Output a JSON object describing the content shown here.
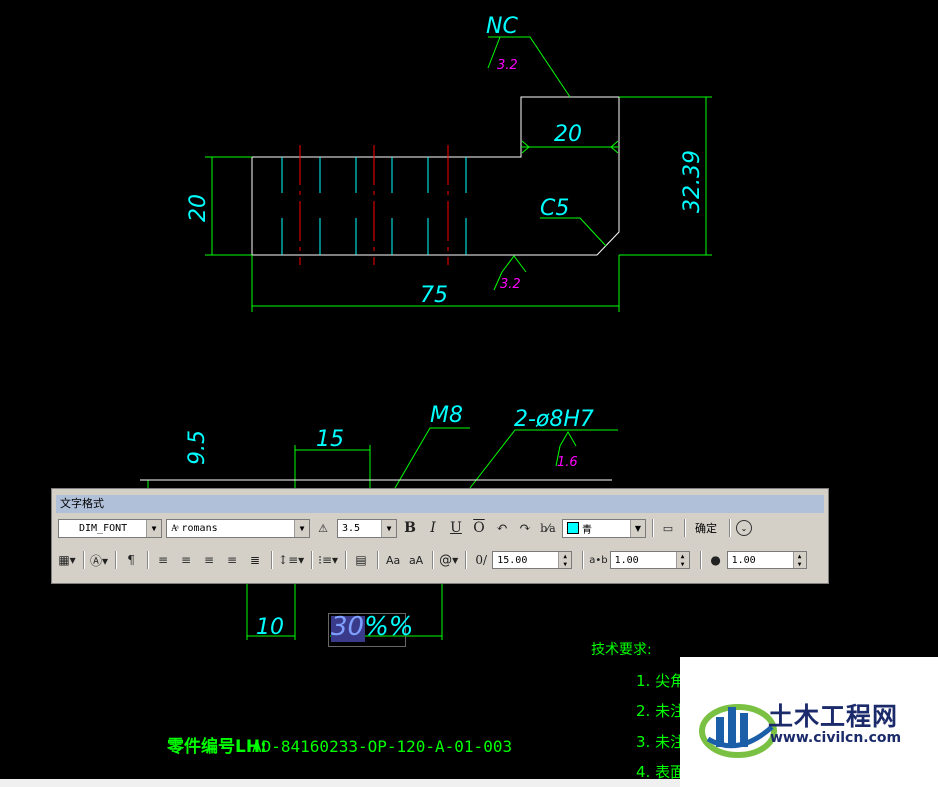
{
  "drawing": {
    "top_view": {
      "dim_top_width": "20",
      "dim_height_total": "32.39",
      "dim_left_height": "20",
      "dim_length": "75",
      "chamfer_label": "C5",
      "surface_symbol_top_label": "NC",
      "roughness_top": "3.2",
      "roughness_bottom": "3.2"
    },
    "side_view": {
      "dim_vertical": "9.5",
      "dim_15": "15",
      "thread_label": "M8",
      "hole_label": "2-ø8H7",
      "roughness_hole": "1.6",
      "dim_10": "10"
    },
    "notes": {
      "heading": "技术要求:",
      "items": [
        "1. 尖角",
        "2. 未注",
        "3. 未注",
        "4. 表面"
      ]
    },
    "part_number": {
      "label": "零件编号LH:",
      "value": "AD-84160233-OP-120-A-01-003"
    }
  },
  "editor": {
    "text_before": "",
    "selected_text": "30",
    "text_after": "%%"
  },
  "toolbar": {
    "title": "文字格式",
    "style_name": "DIM_FONT",
    "font_name": "romans",
    "text_height": "3.5",
    "bold_label": "B",
    "italic_label": "I",
    "underline_label": "U",
    "overline_label": "O",
    "color_label": "青",
    "ok_label": "确定",
    "oblique_value": "15.00",
    "tracking_value": "1.00",
    "width_value": "1.00",
    "case_upper_label": "Aa",
    "case_lower_label": "aA",
    "symbol_label": "@"
  },
  "colors": {
    "geometry": "#ffffff",
    "dimension": "#00ff00",
    "text_cyan": "#00ffff",
    "centerline": "#ff0000",
    "roughness_magenta": "#ff00ff"
  },
  "logo": {
    "name": "土木工程网",
    "url": "www.civilcn.com"
  }
}
